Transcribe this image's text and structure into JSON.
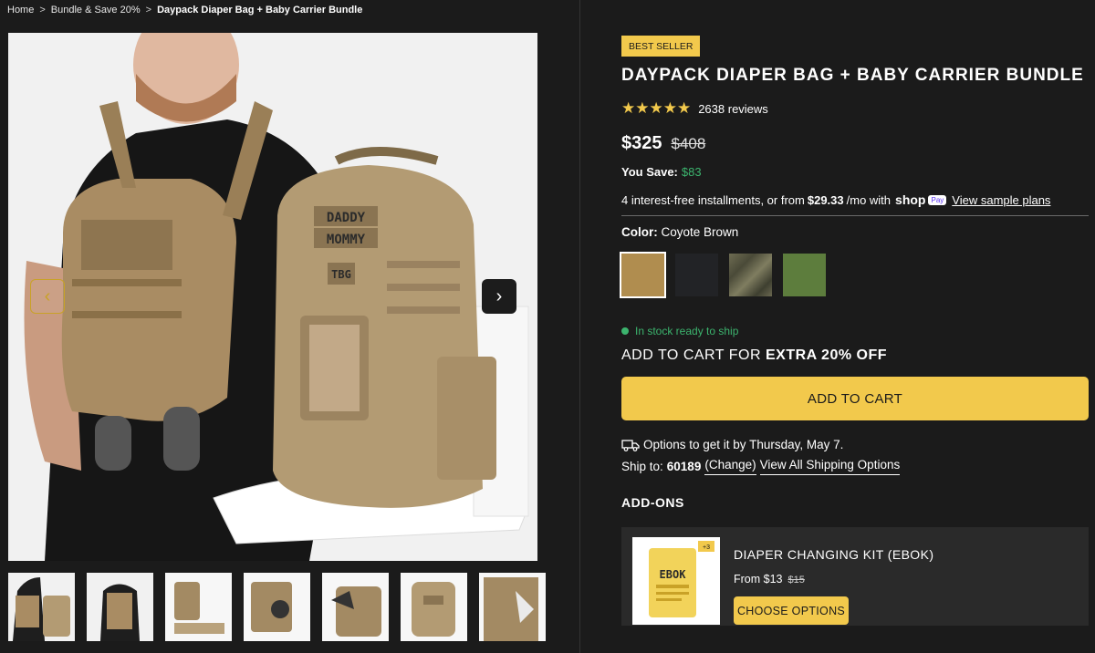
{
  "breadcrumb": {
    "home": "Home",
    "category": "Bundle & Save 20%",
    "current": "Daypack Diaper Bag + Baby Carrier Bundle",
    "separator": ">"
  },
  "gallery": {
    "prev_icon": "chevron-left-icon",
    "next_icon": "chevron-right-icon",
    "prev_glyph": "‹",
    "next_glyph": "›",
    "main_image_text": {
      "patch_daddy": "DADDY",
      "patch_mommy": "MOMMY",
      "patch_tbg": "TBG"
    },
    "thumbnail_count": 7
  },
  "product": {
    "badge": "BEST SELLER",
    "title": "DAYPACK DIAPER BAG + BABY CARRIER BUNDLE",
    "stars": "★★★★★",
    "rating": 5,
    "reviews": "2638 reviews",
    "price": "$325",
    "compare_price": "$408",
    "you_save_label": "You Save:",
    "you_save_amount": "$83",
    "installments_prefix": "4 interest-free installments, or from",
    "installments_amount": "$29.33",
    "installments_suffix": "/mo with",
    "shop_pay_logo": "shop",
    "shop_pay_tag": "Pay",
    "sample_plans_link": "View sample plans",
    "color_label": "Color:",
    "color_value": "Coyote Brown",
    "swatches": [
      {
        "name": "Coyote Brown",
        "color": "#b08d4f",
        "selected": true
      },
      {
        "name": "Black",
        "color": "#222326",
        "selected": false
      },
      {
        "name": "Camo",
        "color": "#5b5a45",
        "selected": false
      },
      {
        "name": "Green",
        "color": "#5d7d3d",
        "selected": false
      }
    ],
    "stock_text": "In stock ready to ship",
    "promo_prefix": "ADD TO CART FOR",
    "promo_bold": "EXTRA 20% OFF",
    "add_to_cart": "ADD TO CART"
  },
  "shipping": {
    "truck_icon": "truck-icon",
    "options_text": "Options to get it by Thursday, May 7.",
    "ship_to_label": "Ship to:",
    "zip": "60189",
    "change_link": "(Change)",
    "view_all_link": "View All Shipping Options"
  },
  "addons": {
    "title": "ADD-ONS",
    "items": [
      {
        "name": "DIAPER CHANGING KIT (EBOK)",
        "price_prefix": "From",
        "price": "$13",
        "compare_price": "$15",
        "button": "CHOOSE OPTIONS",
        "image_label": "EBOK",
        "image_corner": "+3"
      }
    ]
  },
  "colors": {
    "accent": "#f2c94c",
    "background": "#1b1b1b",
    "success": "#3cb46e"
  }
}
